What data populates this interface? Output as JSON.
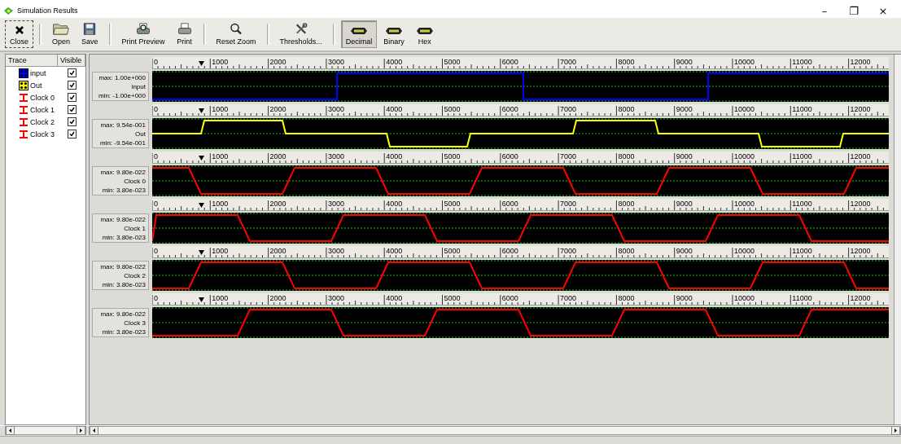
{
  "window": {
    "title": "Simulation Results",
    "controls": [
      "–",
      "❐",
      "×"
    ]
  },
  "toolbar": [
    {
      "label": "Close",
      "selected": false,
      "focused": true,
      "separator_after": true
    },
    {
      "label": "Open",
      "selected": false,
      "focused": false,
      "separator_after": false
    },
    {
      "label": "Save",
      "selected": false,
      "focused": false,
      "separator_after": true
    },
    {
      "label": "Print Preview",
      "selected": false,
      "focused": false,
      "separator_after": false
    },
    {
      "label": "Print",
      "selected": false,
      "focused": false,
      "separator_after": true
    },
    {
      "label": "Reset Zoom",
      "selected": false,
      "focused": false,
      "separator_after": true
    },
    {
      "label": "Thresholds...",
      "selected": false,
      "focused": false,
      "separator_after": true
    },
    {
      "label": "Decimal",
      "selected": true,
      "focused": false,
      "separator_after": false
    },
    {
      "label": "Binary",
      "selected": false,
      "focused": false,
      "separator_after": false
    },
    {
      "label": "Hex",
      "selected": false,
      "focused": false,
      "separator_after": false
    }
  ],
  "trace_table": {
    "columns": [
      "Trace",
      "Visible"
    ],
    "rows": [
      {
        "name": "input",
        "kind": "data",
        "color": "#0000ff",
        "visible": true
      },
      {
        "name": "Out",
        "kind": "data",
        "color": "#ffff00",
        "visible": true
      },
      {
        "name": "Clock 0",
        "kind": "clock",
        "color": "#ff0000",
        "visible": true
      },
      {
        "name": "Clock 1",
        "kind": "clock",
        "color": "#ff0000",
        "visible": true
      },
      {
        "name": "Clock 2",
        "kind": "clock",
        "color": "#ff0000",
        "visible": true
      },
      {
        "name": "Clock 3",
        "kind": "clock",
        "color": "#ff0000",
        "visible": true
      }
    ]
  },
  "tracks": [
    {
      "max": "max: 1.00e+000",
      "name": "input",
      "min": "min: -1.00e+000",
      "color": "#0000ff",
      "ruler_labels": [
        "0",
        "1000",
        "2000",
        "3000",
        "4000",
        "5000",
        "6000",
        "7000",
        "8000",
        "9000",
        "10000",
        "11000",
        "12000"
      ]
    },
    {
      "max": "max: 9.54e-001",
      "name": "Out",
      "min": "min: -9.54e-001",
      "color": "#ffff00",
      "ruler_labels": [
        "0",
        "1000",
        "2000",
        "3000",
        "4000",
        "5000",
        "6000",
        "7000",
        "8000",
        "9000",
        "10000",
        "11000",
        "12000"
      ]
    },
    {
      "max": "max: 9.80e-022",
      "name": "Clock 0",
      "min": "min: 3.80e-023",
      "color": "#ff0000",
      "ruler_labels": [
        "0",
        "1000",
        "2000",
        "3000",
        "4000",
        "5000",
        "6000",
        "7000",
        "8000",
        "9000",
        "10000",
        "11000",
        "12000"
      ]
    },
    {
      "max": "max: 9.80e-022",
      "name": "Clock 1",
      "min": "min: 3.80e-023",
      "color": "#ff0000",
      "ruler_labels": [
        "0",
        "1000",
        "2000",
        "3000",
        "4000",
        "5000",
        "6000",
        "7000",
        "8000",
        "9000",
        "10000",
        "11000",
        "12000"
      ]
    },
    {
      "max": "max: 9.80e-022",
      "name": "Clock 2",
      "min": "min: 3.80e-023",
      "color": "#ff0000",
      "ruler_labels": [
        "0",
        "1000",
        "2000",
        "3000",
        "4000",
        "5000",
        "6000",
        "7000",
        "8000",
        "9000",
        "10000",
        "11000",
        "12000"
      ]
    },
    {
      "max": "max: 9.80e-022",
      "name": "Clock 3",
      "min": "min: 3.80e-023",
      "color": "#ff0000",
      "ruler_labels": [
        "0",
        "1000",
        "2000",
        "3000",
        "4000",
        "5000",
        "6000",
        "7000",
        "8000",
        "9000",
        "10000",
        "11000",
        "12000"
      ]
    }
  ]
}
